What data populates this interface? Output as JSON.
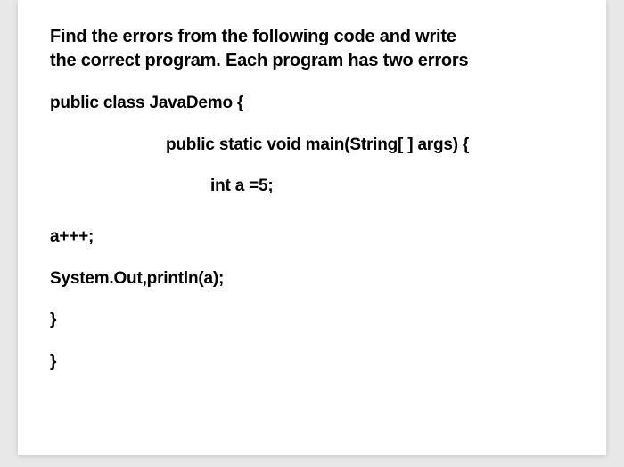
{
  "prompt_line1": " Find the errors from the following code and write",
  "prompt_line2": "the correct program. Each program has two errors",
  "code": {
    "line1": "public class JavaDemo {",
    "line2": "public static void main(String[ ] args) {",
    "line3": "int a =5;",
    "line4": "a+++;",
    "line5": "System.Out,println(a);",
    "line6": "}",
    "line7": "}"
  }
}
